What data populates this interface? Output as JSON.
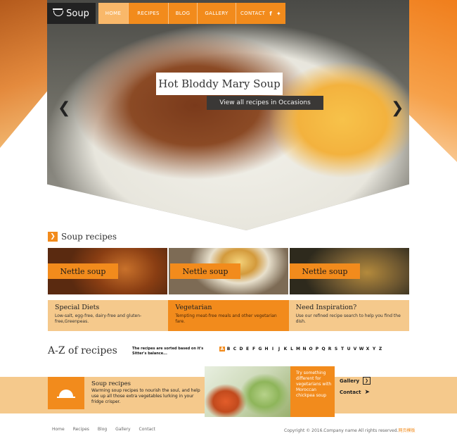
{
  "header": {
    "logo_text": "Soup",
    "nav": [
      {
        "label": "HOME"
      },
      {
        "label": "RECIPES"
      },
      {
        "label": "BLOG"
      },
      {
        "label": "GALLERY"
      },
      {
        "label": "CONTACT"
      }
    ],
    "social": {
      "facebook": "f",
      "twitter": "t"
    }
  },
  "hero": {
    "title": "Hot Bloddy Mary Soup",
    "link_text": "View all recipes in Occasions",
    "prev_icon": "chevron-left-icon",
    "next_icon": "chevron-right-icon"
  },
  "soup_recipes": {
    "heading": "Soup recipes",
    "cards": [
      {
        "label": "Nettle soup"
      },
      {
        "label": "Nettle soup"
      },
      {
        "label": "Nettle soup"
      }
    ]
  },
  "info": [
    {
      "title": "Special Diets",
      "text": "Low-salt, egg-free, dairy-free and gluten-free,Greenpeas."
    },
    {
      "title": "Vegetarian",
      "text": "Tempting meat-free meals and other vegetarian fare."
    },
    {
      "title": "Need Inspiration?",
      "text": "Use our refined recipe search to help you find the dish."
    }
  ],
  "az": {
    "title": "A-Z of recipes",
    "desc": "The recipes are sorted based on it's Sitter's balance...",
    "letters": [
      "A",
      "B",
      "C",
      "D",
      "E",
      "F",
      "G",
      "H",
      "I",
      "J",
      "K",
      "L",
      "M",
      "N",
      "O",
      "P",
      "Q",
      "R",
      "S",
      "T",
      "U",
      "V",
      "W",
      "X",
      "Y",
      "Z"
    ],
    "active": "A"
  },
  "strip": {
    "title": "Soup recipes",
    "text": "Warming soup recipes to nourish the soul, and help use up all those extra vegetables lurking in your fridge crisper.",
    "promo": "Try something different for vegetarians with Moroccan chickpea soup",
    "links": [
      {
        "label": "Gallery",
        "icon": "arrow-right-icon"
      },
      {
        "label": "Contact",
        "icon": "paper-plane-icon"
      }
    ]
  },
  "footer": {
    "links": [
      "Home",
      "Recipes",
      "Blog",
      "Gallery",
      "Contact"
    ],
    "copyright": "Copyright © 2016.Company name All rights reserved.",
    "copyright_brand": "网页模板"
  },
  "colors": {
    "accent": "#f28b1c",
    "light_accent": "#f5c98c",
    "dark": "#222222"
  }
}
